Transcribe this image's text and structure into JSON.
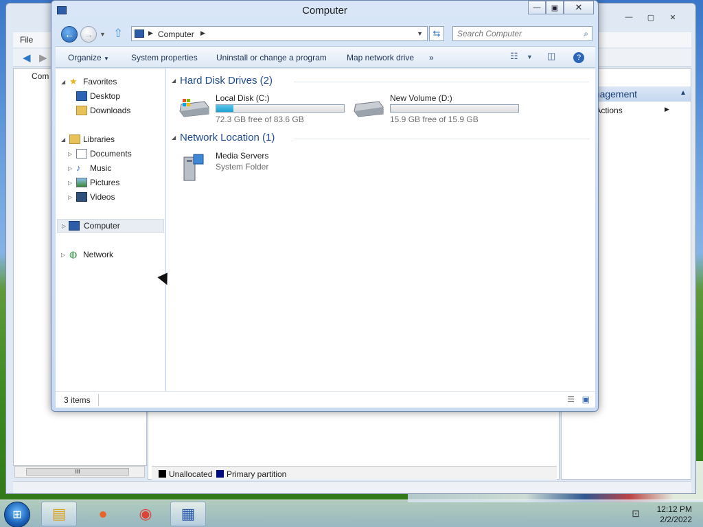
{
  "explorer": {
    "title": "Computer",
    "address": {
      "crumb": "Computer",
      "search_placeholder": "Search Computer"
    },
    "commands": [
      "Organize",
      "System properties",
      "Uninstall or change a program",
      "Map network drive"
    ],
    "more_label": "»",
    "nav": {
      "favorites": "Favorites",
      "desktop": "Desktop",
      "downloads": "Downloads",
      "libraries": "Libraries",
      "documents": "Documents",
      "music": "Music",
      "pictures": "Pictures",
      "videos": "Videos",
      "computer": "Computer",
      "network": "Network"
    },
    "groups": {
      "hdd": "Hard Disk Drives (2)",
      "net": "Network Location (1)"
    },
    "drives": [
      {
        "name": "Local Disk (C:)",
        "free": "72.3 GB free of 83.6 GB",
        "used_fraction": 0.135
      },
      {
        "name": "New Volume (D:)",
        "free": "15.9 GB free of 15.9 GB",
        "used_fraction": 0.0
      }
    ],
    "network_item": {
      "name": "Media Servers",
      "type": "System Folder"
    },
    "status": {
      "count": "3 items"
    }
  },
  "background_window": {
    "menu_file": "File",
    "tree_label": "Com",
    "actions_header": "anagement",
    "actions_more": "e Actions",
    "legend": [
      {
        "label": "Unallocated",
        "color": "#000000"
      },
      {
        "label": "Primary partition",
        "color": "#000a80"
      }
    ]
  },
  "taskbar": {
    "time": "12:12 PM",
    "date": "2/2/2022",
    "apps": [
      "explorer-icon",
      "firefox-icon",
      "chrome-icon",
      "computer-management-icon"
    ]
  },
  "colors": {
    "accent": "#1e4b8f",
    "drive_fill": "#1aa0d0"
  }
}
